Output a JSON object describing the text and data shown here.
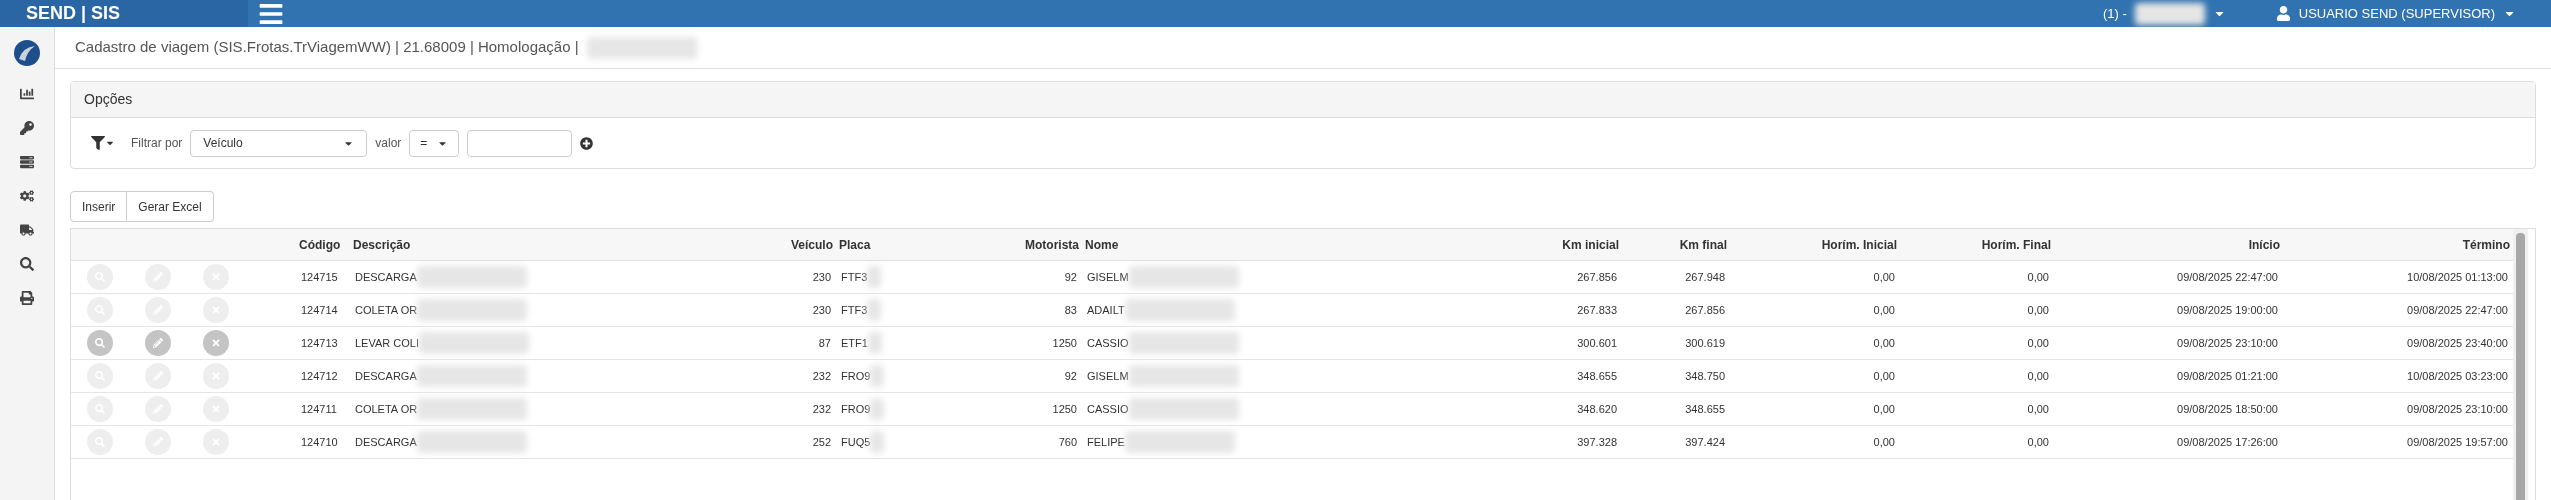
{
  "topbar": {
    "brand": "SEND | SIS",
    "company": "(1) -",
    "user": "USUARIO SEND (SUPERVISOR)"
  },
  "page_title": "Cadastro de viagem (SIS.Frotas.TrViagemWW) | 21.68009 | Homologação |",
  "options": {
    "title": "Opções",
    "filter_label": "Filtrar por",
    "filter_field": "Veículo",
    "value_label": "valor",
    "operator": "="
  },
  "buttons": [
    "Inserir",
    "Gerar Excel"
  ],
  "table": {
    "columns": [
      "Código",
      "Descrição",
      "Veículo",
      "Placa",
      "Motorista",
      "Nome",
      "Km inicial",
      "Km final",
      "Horím. Inicial",
      "Horím. Final",
      "Início",
      "Término"
    ],
    "rows": [
      {
        "hovered": false,
        "cells": [
          "124715",
          "DESCARGA",
          "230",
          "FTF3",
          "92",
          "GISELM",
          "267.856",
          "267.948",
          "0,00",
          "0,00",
          "09/08/2025 22:47:00",
          "10/08/2025 01:13:00"
        ]
      },
      {
        "hovered": false,
        "cells": [
          "124714",
          "COLETA OR",
          "230",
          "FTF3",
          "83",
          "ADAILT",
          "267.833",
          "267.856",
          "0,00",
          "0,00",
          "09/08/2025 19:00:00",
          "09/08/2025 22:47:00"
        ]
      },
      {
        "hovered": true,
        "cells": [
          "124713",
          "LEVAR COLI",
          "87",
          "ETF1",
          "1250",
          "CASSIO",
          "300.601",
          "300.619",
          "0,00",
          "0,00",
          "09/08/2025 23:10:00",
          "09/08/2025 23:40:00"
        ]
      },
      {
        "hovered": false,
        "cells": [
          "124712",
          "DESCARGA",
          "232",
          "FRO9",
          "92",
          "GISELM",
          "348.655",
          "348.750",
          "0,00",
          "0,00",
          "09/08/2025 01:21:00",
          "10/08/2025 03:23:00"
        ]
      },
      {
        "hovered": false,
        "cells": [
          "124711",
          "COLETA OR",
          "232",
          "FRO9",
          "1250",
          "CASSIO",
          "348.620",
          "348.655",
          "0,00",
          "0,00",
          "09/08/2025 18:50:00",
          "09/08/2025 23:10:00"
        ]
      },
      {
        "hovered": false,
        "cells": [
          "124710",
          "DESCARGA",
          "252",
          "FUQ5",
          "760",
          "FELIPE",
          "397.328",
          "397.424",
          "0,00",
          "0,00",
          "09/08/2025 17:26:00",
          "09/08/2025 19:57:00"
        ]
      }
    ]
  }
}
